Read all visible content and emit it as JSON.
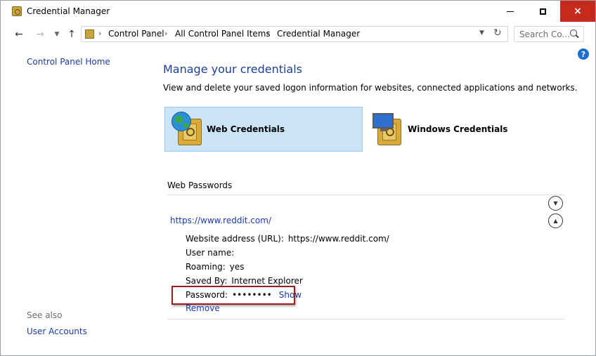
{
  "window": {
    "title": "Credential Manager",
    "controls": {
      "minimize": "Minimize",
      "maximize": "Maximize",
      "close": "×"
    }
  },
  "address": {
    "breadcrumbs": [
      "Control Panel",
      "All Control Panel Items",
      "Credential Manager"
    ],
    "separator": "›",
    "search_placeholder": "Search Co..."
  },
  "help_label": "?",
  "sidebar": {
    "home_link": "Control Panel Home",
    "see_also": "See also",
    "user_accounts": "User Accounts"
  },
  "main": {
    "heading": "Manage your credentials",
    "description": "View and delete your saved logon information for websites, connected applications and networks.",
    "tiles": [
      {
        "label": "Web Credentials",
        "selected": true
      },
      {
        "label": "Windows Credentials",
        "selected": false
      }
    ],
    "section_title": "Web Passwords",
    "credential": {
      "site": "https://www.reddit.com/",
      "fields": [
        {
          "label": "Website address (URL):",
          "value": "https://www.reddit.com/"
        },
        {
          "label": "User name:",
          "value": ""
        },
        {
          "label": "Roaming:",
          "value": "yes"
        },
        {
          "label": "Saved By:",
          "value": "Internet Explorer"
        }
      ],
      "password_label": "Password:",
      "password_mask": "••••••••",
      "show_label": "Show",
      "remove_label": "Remove"
    }
  },
  "colors": {
    "link": "#1a3aa8",
    "heading": "#1e3f98",
    "selected_tile": "#cce4f7",
    "close_button": "#c42b1c",
    "highlight_box": "#9e1b1f"
  }
}
